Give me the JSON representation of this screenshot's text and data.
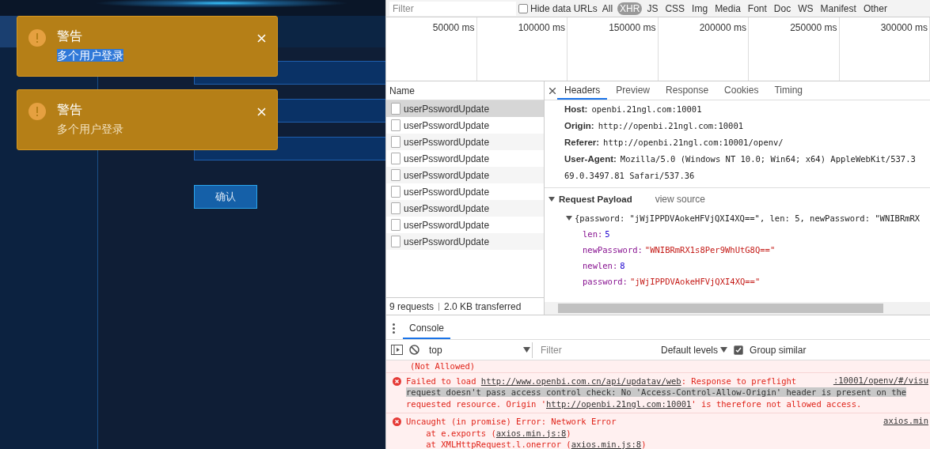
{
  "app": {
    "sidebar": [
      {
        "selected": true
      },
      {
        "selected": false
      }
    ],
    "fields": [
      {
        "kind": "input"
      },
      {
        "kind": "input"
      },
      {
        "kind": "input"
      }
    ],
    "confirm_button": "确认"
  },
  "notifications": [
    {
      "title": "警告",
      "message": "多个用户登录",
      "highlighted": true
    },
    {
      "title": "警告",
      "message": "多个用户登录",
      "highlighted": false
    }
  ],
  "devtools": {
    "filter": {
      "placeholder": "Filter"
    },
    "hide_data_urls": {
      "label": "Hide data URLs",
      "checked": false
    },
    "type_filters": [
      {
        "label": "All",
        "selected": false
      },
      {
        "label": "XHR",
        "selected": true
      },
      {
        "label": "JS",
        "selected": false
      },
      {
        "label": "CSS",
        "selected": false
      },
      {
        "label": "Img",
        "selected": false
      },
      {
        "label": "Media",
        "selected": false
      },
      {
        "label": "Font",
        "selected": false
      },
      {
        "label": "Doc",
        "selected": false
      },
      {
        "label": "WS",
        "selected": false
      },
      {
        "label": "Manifest",
        "selected": false
      },
      {
        "label": "Other",
        "selected": false
      }
    ],
    "timeline_ticks": [
      "50000 ms",
      "100000 ms",
      "150000 ms",
      "200000 ms",
      "250000 ms",
      "300000 ms"
    ],
    "requests": {
      "header": "Name",
      "rows": [
        {
          "name": "userPsswordUpdate",
          "selected": true
        },
        {
          "name": "userPsswordUpdate",
          "selected": false
        },
        {
          "name": "userPsswordUpdate",
          "selected": false
        },
        {
          "name": "userPsswordUpdate",
          "selected": false
        },
        {
          "name": "userPsswordUpdate",
          "selected": false
        },
        {
          "name": "userPsswordUpdate",
          "selected": false
        },
        {
          "name": "userPsswordUpdate",
          "selected": false
        },
        {
          "name": "userPsswordUpdate",
          "selected": false
        },
        {
          "name": "userPsswordUpdate",
          "selected": false
        }
      ],
      "summary": [
        "9 requests",
        "2.0 KB transferred"
      ]
    },
    "detail_tabs": [
      {
        "label": "Headers",
        "selected": true
      },
      {
        "label": "Preview",
        "selected": false
      },
      {
        "label": "Response",
        "selected": false
      },
      {
        "label": "Cookies",
        "selected": false
      },
      {
        "label": "Timing",
        "selected": false
      }
    ],
    "headers": [
      {
        "name": "Host:",
        "value": "openbi.21ngl.com:10001"
      },
      {
        "name": "Origin:",
        "value": "http://openbi.21ngl.com:10001"
      },
      {
        "name": "Referer:",
        "value": "http://openbi.21ngl.com:10001/openv/"
      },
      {
        "name": "User-Agent:",
        "value": "Mozilla/5.0 (Windows NT 10.0; Win64; x64) AppleWebKit/537.3"
      }
    ],
    "header_continuation": "69.0.3497.81 Safari/537.36",
    "payload": {
      "title": "Request Payload",
      "expanded": true,
      "view_source": "view source",
      "summary": "{password: \"jWjIPPDVAokeHFVjQXI4XQ==\", len: 5, newPassword: \"WNIBRmRX",
      "summary_expanded": true,
      "props": [
        {
          "key": "len:",
          "value": "5",
          "kind": "number"
        },
        {
          "key": "newPassword:",
          "value": "\"WNIBRmRX1s8Per9WhUtG8Q==\"",
          "kind": "string"
        },
        {
          "key": "newlen:",
          "value": "8",
          "kind": "number"
        },
        {
          "key": "password:",
          "value": "\"jWjIPPDVAokeHFVjQXI4XQ==\"",
          "kind": "string"
        }
      ]
    },
    "console": {
      "tabs": [
        {
          "label": "Console",
          "selected": true
        }
      ],
      "context": "top",
      "filter_placeholder": "Filter",
      "levels": "Default levels",
      "group_similar": {
        "label": "Group similar",
        "checked": true
      },
      "messages": [
        {
          "kind": "continuation",
          "lines": [
            [
              {
                "kind": "text",
                "text": "(Not Allowed)"
              }
            ]
          ]
        },
        {
          "kind": "error",
          "source": ":10001/openv/#/visu",
          "lines": [
            [
              {
                "kind": "text",
                "text": "Failed to load "
              },
              {
                "kind": "link",
                "text": "http://www.openbi.com.cn/api/updatav/web"
              },
              {
                "kind": "text",
                "text": ": Response to preflight"
              }
            ],
            [
              {
                "kind": "highlight",
                "text": "request doesn't pass access control check: No 'Access-Control-Allow-Origin' header is present on the"
              }
            ],
            [
              {
                "kind": "text",
                "text": "requested resource. Origin '"
              },
              {
                "kind": "link",
                "text": "http://openbi.21ngl.com:10001"
              },
              {
                "kind": "text",
                "text": "' is therefore not allowed access."
              }
            ]
          ]
        },
        {
          "kind": "error",
          "source": "axios.min",
          "lines": [
            [
              {
                "kind": "text",
                "text": "Uncaught (in promise) Error: Network Error"
              }
            ],
            [
              {
                "kind": "text",
                "text": "    at e.exports ("
              },
              {
                "kind": "link",
                "text": "axios.min.js:8"
              },
              {
                "kind": "text",
                "text": ")"
              }
            ],
            [
              {
                "kind": "text",
                "text": "    at XMLHttpRequest.l.onerror ("
              },
              {
                "kind": "link",
                "text": "axios.min.js:8"
              },
              {
                "kind": "text",
                "text": ")"
              }
            ]
          ]
        }
      ]
    }
  }
}
